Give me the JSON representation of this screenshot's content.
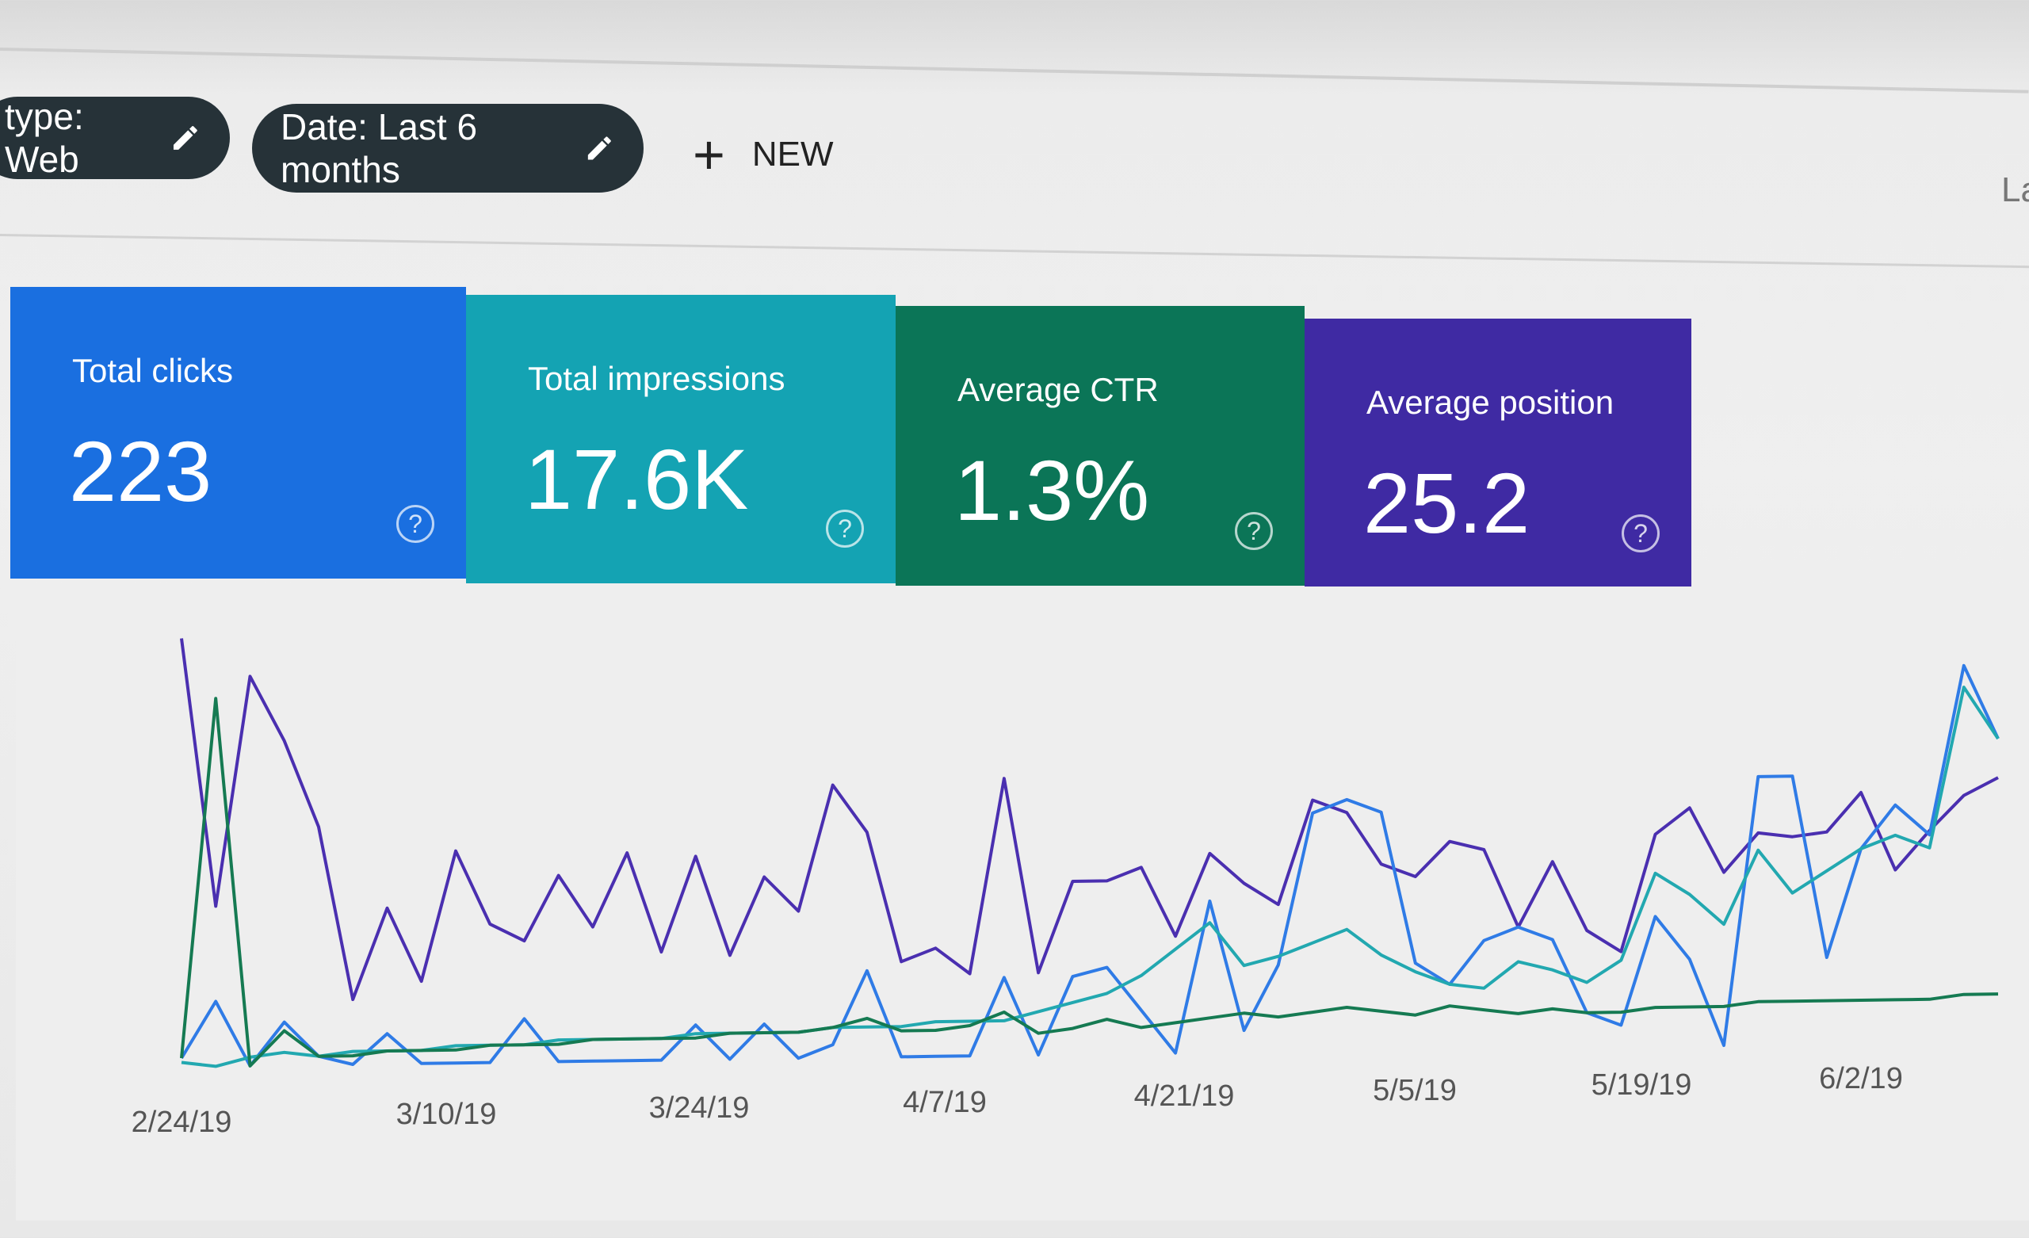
{
  "filters": {
    "type_chip": "type: Web",
    "date_chip": "Date: Last 6 months",
    "new_label": "NEW",
    "cut_off_text": "La"
  },
  "cards": [
    {
      "label": "Total clicks",
      "value": "223",
      "color": "#1a6fe0"
    },
    {
      "label": "Total impressions",
      "value": "17.6K",
      "color": "#14a3b3"
    },
    {
      "label": "Average CTR",
      "value": "1.3%",
      "color": "#0b7557"
    },
    {
      "label": "Average position",
      "value": "25.2",
      "color": "#3f2aa3"
    }
  ],
  "help_icon": "?",
  "chart_data": {
    "type": "line",
    "title": "",
    "xlabel": "",
    "ylabel": "",
    "grid": false,
    "legend": "none",
    "x_tick_labels": [
      "2/24/19",
      "3/10/19",
      "3/24/19",
      "4/7/19",
      "4/21/19",
      "5/5/19",
      "5/19/19",
      "6/2/19"
    ],
    "x": [
      "2/24/19",
      "2/26/19",
      "2/28/19",
      "3/2/19",
      "3/4/19",
      "3/6/19",
      "3/8/19",
      "3/10/19",
      "3/12/19",
      "3/14/19",
      "3/16/19",
      "3/18/19",
      "3/20/19",
      "3/22/19",
      "3/24/19",
      "3/26/19",
      "3/28/19",
      "3/30/19",
      "4/1/19",
      "4/3/19",
      "4/5/19",
      "4/7/19",
      "4/9/19",
      "4/11/19",
      "4/13/19",
      "4/15/19",
      "4/17/19",
      "4/19/19",
      "4/21/19",
      "4/23/19",
      "4/25/19",
      "4/27/19",
      "4/29/19",
      "5/1/19",
      "5/3/19",
      "5/5/19",
      "5/7/19",
      "5/9/19",
      "5/11/19",
      "5/13/19",
      "5/15/19",
      "5/17/19",
      "5/19/19",
      "5/21/19",
      "5/23/19",
      "5/25/19",
      "5/27/19",
      "5/29/19",
      "5/31/19",
      "6/2/19",
      "6/4/19",
      "6/6/19",
      "6/8/19",
      "6/10/19"
    ],
    "y_scale": "relative (0-100), per-series axes not shown",
    "series": [
      {
        "key": "position",
        "color": "#4a2fb0",
        "values": [
          99,
          37,
          90,
          75,
          55,
          15,
          36,
          19,
          49,
          32,
          28,
          43,
          31,
          48,
          25,
          47,
          24,
          42,
          34,
          63,
          52,
          22,
          25,
          19,
          64,
          19,
          40,
          40,
          43,
          27,
          46,
          39,
          34,
          58,
          55,
          43,
          40,
          48,
          46,
          28,
          43,
          27,
          22,
          49,
          55,
          40,
          49,
          48,
          49,
          58,
          40,
          49,
          57,
          61
        ]
      },
      {
        "key": "clicks",
        "color": "#2f7be6",
        "values": [
          2,
          15,
          0,
          10,
          2,
          0,
          7,
          0,
          0,
          0,
          10,
          0,
          0,
          0,
          0,
          8,
          0,
          8,
          0,
          3,
          20,
          0,
          0,
          0,
          18,
          0,
          18,
          20,
          10,
          0,
          35,
          5,
          20,
          55,
          58,
          55,
          20,
          15,
          25,
          28,
          25,
          8,
          5,
          30,
          20,
          0,
          62,
          62,
          20,
          45,
          55,
          48,
          87,
          70
        ]
      },
      {
        "key": "impressions",
        "color": "#22a8b0",
        "values": [
          1,
          0,
          2,
          3,
          2,
          3,
          3,
          3,
          4,
          4,
          4,
          5,
          5,
          5,
          5,
          6,
          6,
          6,
          6,
          7,
          7,
          7,
          8,
          8,
          8,
          10,
          12,
          14,
          18,
          24,
          30,
          20,
          22,
          25,
          28,
          22,
          18,
          15,
          14,
          20,
          18,
          15,
          20,
          40,
          35,
          28,
          45,
          35,
          40,
          45,
          48,
          45,
          82,
          70
        ]
      },
      {
        "key": "ctr",
        "color": "#157a52",
        "values": [
          2,
          85,
          0,
          8,
          2,
          2,
          3,
          3,
          3,
          4,
          4,
          4,
          5,
          5,
          5,
          5,
          6,
          6,
          6,
          7,
          9,
          6,
          6,
          7,
          10,
          5,
          6,
          8,
          6,
          7,
          8,
          9,
          8,
          9,
          10,
          9,
          8,
          10,
          9,
          8,
          9,
          8,
          8,
          9,
          9,
          9,
          10,
          10,
          10,
          10,
          10,
          10,
          11,
          11
        ]
      }
    ]
  }
}
